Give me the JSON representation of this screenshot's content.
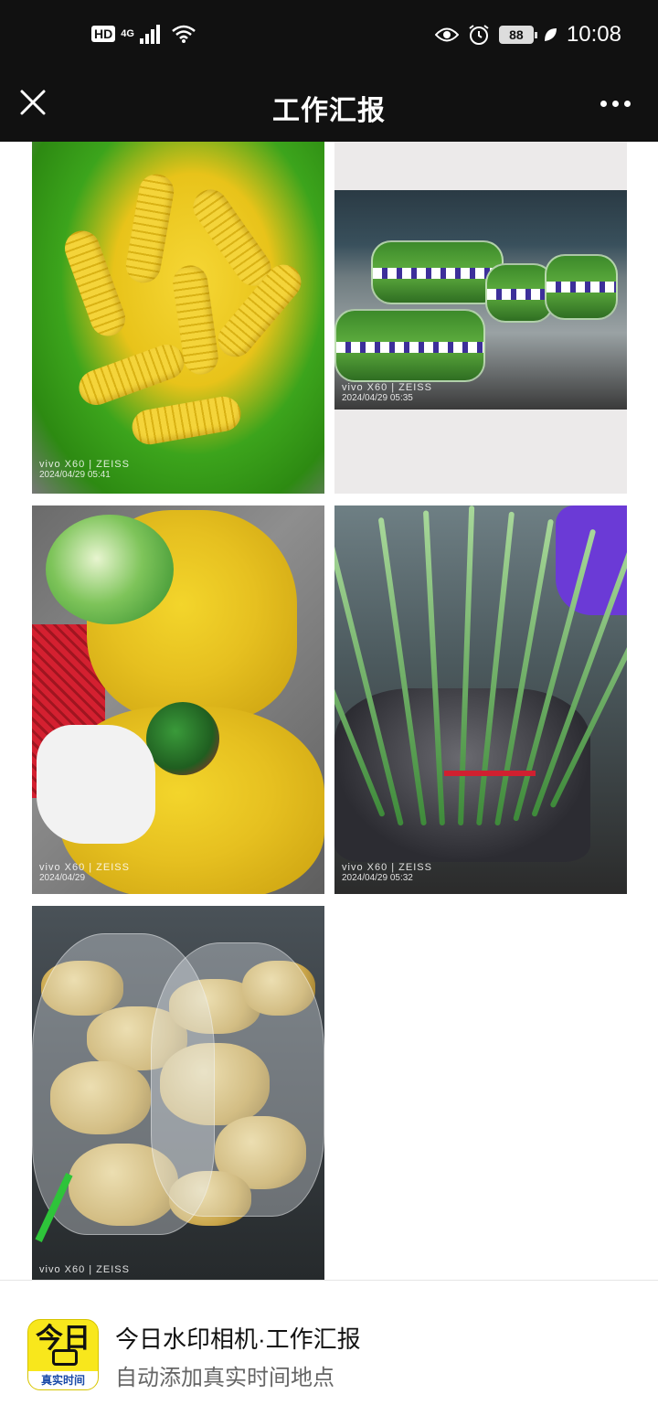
{
  "status_bar": {
    "hd_badge": "HD",
    "network": "4G",
    "battery": "88",
    "time": "10:08",
    "icons": [
      "signal-icon",
      "wifi-icon",
      "eye-icon",
      "alarm-icon",
      "battery-icon",
      "leaf-icon"
    ]
  },
  "nav": {
    "title": "工作汇报",
    "close_icon": "close-icon",
    "more_icon": "more-icon"
  },
  "photos": [
    {
      "subject": "corn",
      "watermark_camera": "vivo X60 | ZEISS",
      "watermark_time": "2024/04/29 05:41"
    },
    {
      "subject": "packaged greens",
      "watermark_camera": "vivo X60 | ZEISS",
      "watermark_time": "2024/04/29 05:35"
    },
    {
      "subject": "cabbage",
      "watermark_camera": "vivo X60 | ZEISS",
      "watermark_time": "2024/04/29"
    },
    {
      "subject": "green garlic",
      "watermark_camera": "vivo X60 | ZEISS",
      "watermark_time": "2024/04/29 05:32"
    },
    {
      "subject": "ginger",
      "watermark_camera": "vivo X60 | ZEISS",
      "watermark_time": ""
    }
  ],
  "footer": {
    "logo_top": "今日",
    "logo_bottom": "真实时间",
    "title": "今日水印相机·工作汇报",
    "subtitle": "自动添加真实时间地点"
  },
  "colors": {
    "bar_background": "#111111",
    "logo_yellow": "#f8e71c",
    "logo_blue": "#1a4aa8"
  }
}
